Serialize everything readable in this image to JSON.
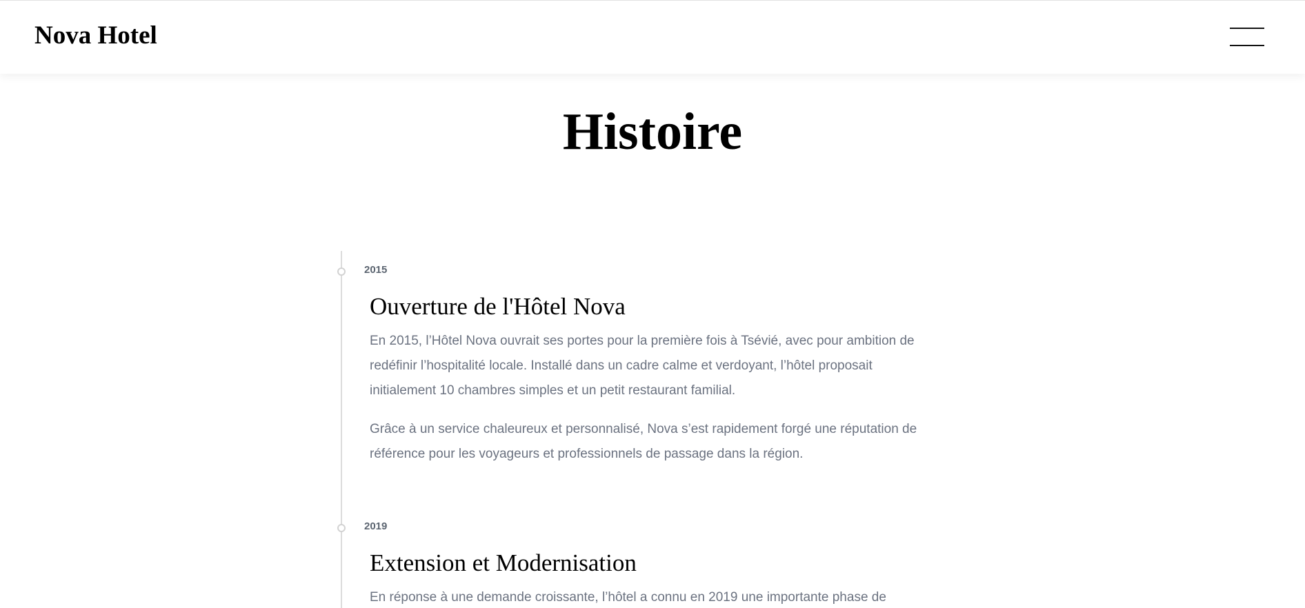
{
  "header": {
    "brand": "Nova Hotel",
    "menu_icon": "hamburger-menu-icon"
  },
  "page": {
    "title": "Histoire"
  },
  "timeline": {
    "entries": [
      {
        "year": "2015",
        "title": "Ouverture de l'Hôtel Nova",
        "paragraphs": [
          "En 2015, l’Hôtel Nova ouvrait ses portes pour la première fois à Tsévié, avec pour ambition de redéfinir l’hospitalité locale. Installé dans un cadre calme et verdoyant, l’hôtel proposait initialement 10 chambres simples et un petit restaurant familial.",
          "Grâce à un service chaleureux et personnalisé, Nova s’est rapidement forgé une réputation de référence pour les voyageurs et professionnels de passage dans la région."
        ]
      },
      {
        "year": "2019",
        "title": "Extension et Modernisation",
        "paragraphs": [
          "En réponse à une demande croissante, l’hôtel a connu en 2019 une importante phase de"
        ]
      }
    ]
  },
  "colors": {
    "background": "#ffffff",
    "heading": "#000000",
    "body_text": "#6b7280",
    "year_text": "#5b6470",
    "timeline_line": "#dcdcdc"
  }
}
